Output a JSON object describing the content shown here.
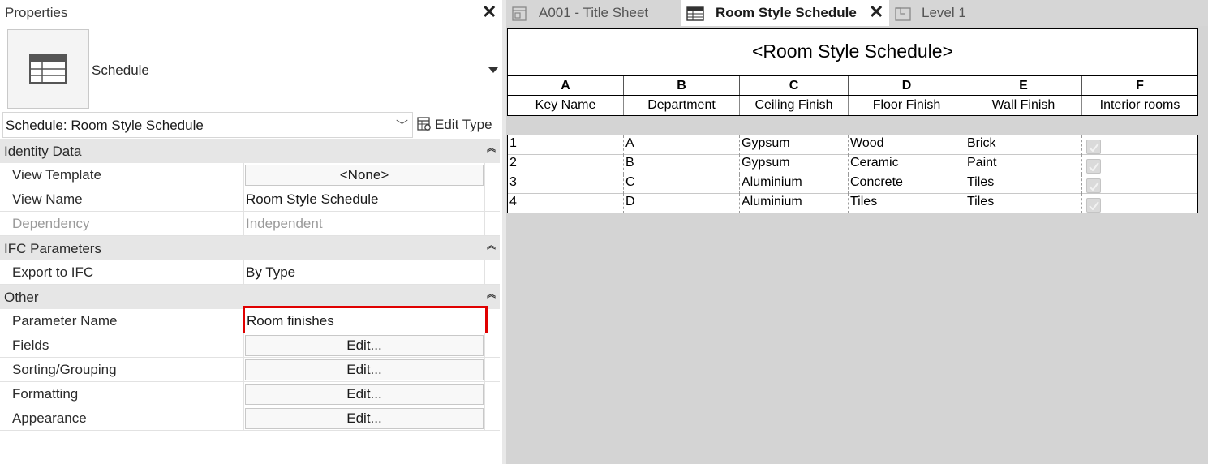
{
  "properties_panel": {
    "title": "Properties",
    "type_selector": {
      "type_name": "Schedule"
    },
    "instance_filter": {
      "value": "Schedule: Room Style Schedule"
    },
    "edit_type_label": "Edit Type",
    "groups": [
      {
        "label": "Identity Data",
        "rows": [
          {
            "name": "View Template",
            "value": "<None>",
            "kind": "button"
          },
          {
            "name": "View Name",
            "value": "Room Style Schedule",
            "kind": "text"
          },
          {
            "name": "Dependency",
            "value": "Independent",
            "kind": "readonly"
          }
        ]
      },
      {
        "label": "IFC Parameters",
        "rows": [
          {
            "name": "Export to IFC",
            "value": "By Type",
            "kind": "text"
          }
        ]
      },
      {
        "label": "Other",
        "rows": [
          {
            "name": "Parameter Name",
            "value": "Room finishes",
            "kind": "highlighted-input"
          },
          {
            "name": "Fields",
            "value": "Edit...",
            "kind": "button"
          },
          {
            "name": "Sorting/Grouping",
            "value": "Edit...",
            "kind": "button"
          },
          {
            "name": "Formatting",
            "value": "Edit...",
            "kind": "button"
          },
          {
            "name": "Appearance",
            "value": "Edit...",
            "kind": "button"
          }
        ]
      }
    ]
  },
  "tabs": [
    {
      "label": "A001 - Title Sheet",
      "active": false,
      "icon": "sheet-icon"
    },
    {
      "label": "Room Style Schedule",
      "active": true,
      "icon": "schedule-icon"
    },
    {
      "label": "Level 1",
      "active": false,
      "icon": "floor-plan-icon"
    }
  ],
  "schedule": {
    "title": "<Room Style Schedule>",
    "column_letters": [
      "A",
      "B",
      "C",
      "D",
      "E",
      "F"
    ],
    "column_headers": [
      "Key Name",
      "Department",
      "Ceiling Finish",
      "Floor Finish",
      "Wall Finish",
      "Interior rooms"
    ],
    "rows": [
      {
        "key": "1",
        "department": "A",
        "ceiling": "Gypsum",
        "floor": "Wood",
        "wall": "Brick",
        "interior": true
      },
      {
        "key": "2",
        "department": "B",
        "ceiling": "Gypsum",
        "floor": "Ceramic",
        "wall": "Paint",
        "interior": true
      },
      {
        "key": "3",
        "department": "C",
        "ceiling": "Aluminium",
        "floor": "Concrete",
        "wall": "Tiles",
        "interior": true
      },
      {
        "key": "4",
        "department": "D",
        "ceiling": "Aluminium",
        "floor": "Tiles",
        "wall": "Tiles",
        "interior": true
      }
    ]
  },
  "colors": {
    "highlight_border": "#e00000",
    "group_header_bg": "#e6e6e6",
    "view_background": "#d4d4d4"
  }
}
